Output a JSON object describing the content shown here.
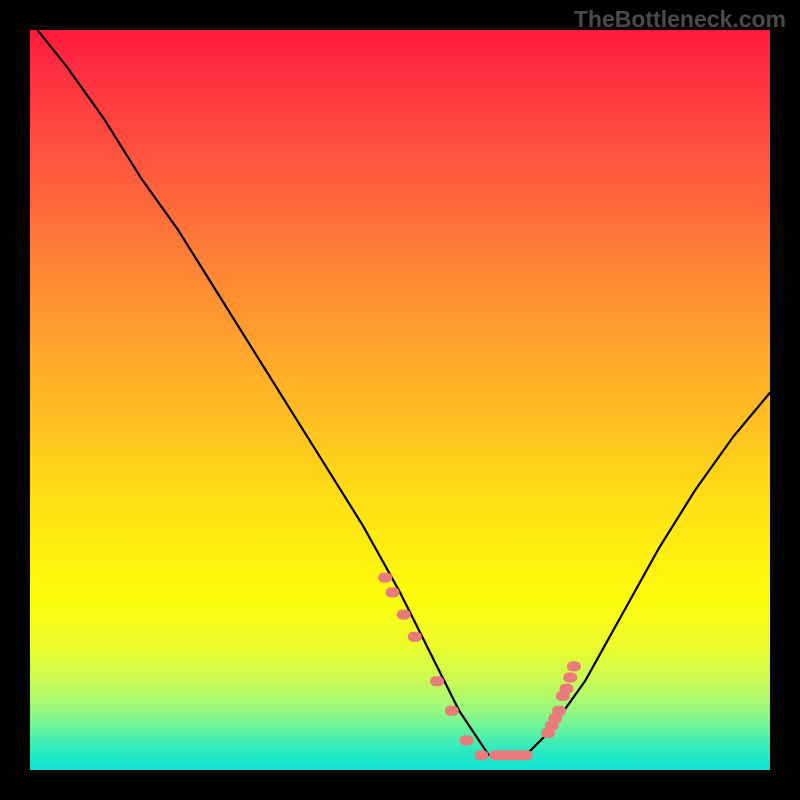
{
  "watermark": "TheBottleneck.com",
  "chart_data": {
    "type": "line",
    "title": "",
    "xlabel": "",
    "ylabel": "",
    "xlim": [
      0,
      100
    ],
    "ylim": [
      0,
      100
    ],
    "grid": false,
    "series": [
      {
        "name": "bottleneck-curve",
        "color": "#000000",
        "x": [
          1,
          5,
          10,
          15,
          20,
          25,
          30,
          35,
          40,
          45,
          50,
          53,
          56,
          58,
          60,
          62,
          65,
          67,
          70,
          75,
          80,
          85,
          90,
          95,
          100
        ],
        "y": [
          100,
          95,
          88,
          80,
          73,
          65,
          57,
          49,
          41,
          33,
          24,
          18,
          12,
          8,
          5,
          2,
          2,
          2,
          5,
          12,
          21,
          30,
          38,
          45,
          51
        ]
      }
    ],
    "markers": [
      {
        "name": "scatter-dots",
        "color": "#e97b7b",
        "x": [
          48,
          49,
          50.5,
          52,
          55,
          57,
          59,
          61,
          63,
          64,
          65,
          66,
          67,
          70,
          70.5,
          71,
          71.5,
          72,
          72.5,
          73,
          73.5
        ],
        "y": [
          26,
          24,
          21,
          18,
          12,
          8,
          4,
          2,
          2,
          2,
          2,
          2,
          2,
          5,
          6,
          7,
          8,
          10,
          11,
          12.5,
          14
        ]
      }
    ],
    "background_gradient": {
      "direction": "vertical",
      "stops": [
        {
          "pos": 0.0,
          "color": "#ff1a3a"
        },
        {
          "pos": 0.25,
          "color": "#ff7a36"
        },
        {
          "pos": 0.5,
          "color": "#ffc21e"
        },
        {
          "pos": 0.75,
          "color": "#fbfb0c"
        },
        {
          "pos": 0.9,
          "color": "#8df78a"
        },
        {
          "pos": 1.0,
          "color": "#0fe3d3"
        }
      ]
    }
  }
}
